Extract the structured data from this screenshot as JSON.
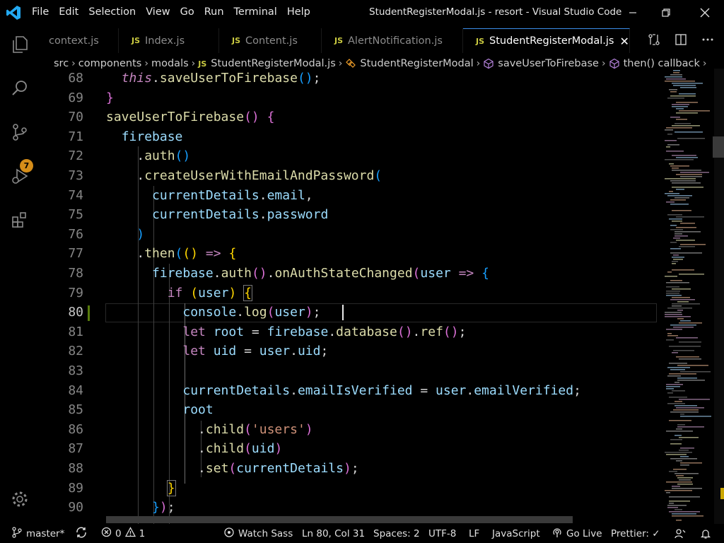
{
  "titlebar": {
    "menu": [
      "File",
      "Edit",
      "Selection",
      "View",
      "Go",
      "Run",
      "Terminal",
      "Help"
    ],
    "window_title": "StudentRegisterModal.js - resort - Visual Studio Code"
  },
  "activity": {
    "scm_badge": "7"
  },
  "tabs": [
    {
      "label": "context.js",
      "js": ""
    },
    {
      "label": "Index.js",
      "js": "JS"
    },
    {
      "label": "Content.js",
      "js": "JS"
    },
    {
      "label": "AlertNotification.js",
      "js": "JS"
    },
    {
      "label": "StudentRegisterModal.js",
      "js": "JS",
      "close": "✕"
    }
  ],
  "breadcrumb": {
    "parts": [
      "src",
      "components",
      "modals"
    ],
    "file_js": "JS",
    "file": "StudentRegisterModal.js",
    "class_name": "StudentRegisterModal",
    "method": "saveUserToFirebase",
    "callback": "then() callback"
  },
  "editor": {
    "line_numbers": [
      "68",
      "69",
      "70",
      "71",
      "72",
      "73",
      "74",
      "75",
      "76",
      "77",
      "78",
      "79",
      "80",
      "81",
      "82",
      "83",
      "84",
      "85",
      "86",
      "87",
      "88",
      "89",
      "90"
    ],
    "current_line": "80"
  },
  "statusbar": {
    "branch": "master*",
    "errors": "0",
    "warnings": "1",
    "watch_sass": "Watch Sass",
    "position": "Ln 80, Col 31",
    "spaces": "Spaces: 2",
    "encoding": "UTF-8",
    "eol": "LF",
    "language": "JavaScript",
    "go_live": "Go Live",
    "prettier": "Prettier: ✓"
  },
  "colors": {
    "accent": "#3b8eea",
    "badge": "#d58d19",
    "keyword": "#c586c0",
    "function": "#dcdcaa",
    "variable": "#9cdcfe",
    "string": "#ce9178"
  }
}
